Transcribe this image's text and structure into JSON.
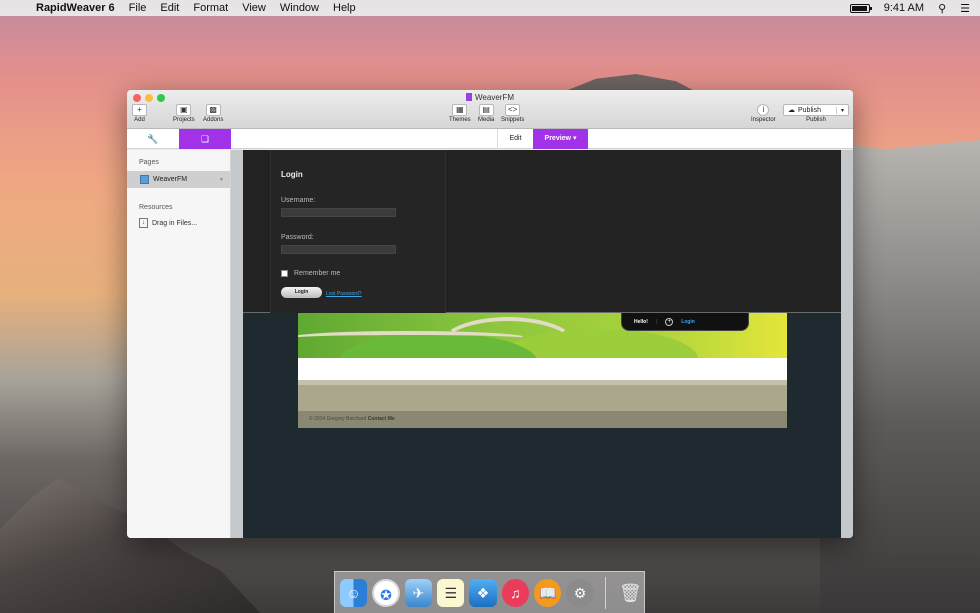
{
  "menubar": {
    "apple_icon": "apple-icon",
    "app_name": "RapidWeaver 6",
    "items": [
      "File",
      "Edit",
      "Format",
      "View",
      "Window",
      "Help"
    ],
    "clock": "9:41 AM"
  },
  "window": {
    "title": "WeaverFM",
    "toolbar": {
      "add": "Add",
      "projects": "Projects",
      "addons": "Addons",
      "themes": "Themes",
      "media": "Media",
      "snippets": "Snippets",
      "inspector": "Inspector",
      "publish_button": "Publish",
      "publish_label": "Publish"
    },
    "tabs": {
      "edit": "Edit",
      "preview": "Preview ▾"
    },
    "sidebar": {
      "pages_header": "Pages",
      "page": "WeaverFM",
      "resources_header": "Resources",
      "drag_in": "Drag in Files..."
    },
    "preview": {
      "login_heading": "Login",
      "username_label": "Username:",
      "password_label": "Password:",
      "remember_label": "Remember me",
      "login_button": "Login",
      "lost_password": "Lost Password?",
      "hello": "Hello!",
      "hello_login": "Login",
      "footer_text": "© 2014 Gregory Barchard",
      "footer_link": "Contact Me"
    }
  },
  "colors": {
    "accent": "#a232e8",
    "link": "#3fa3e6"
  }
}
